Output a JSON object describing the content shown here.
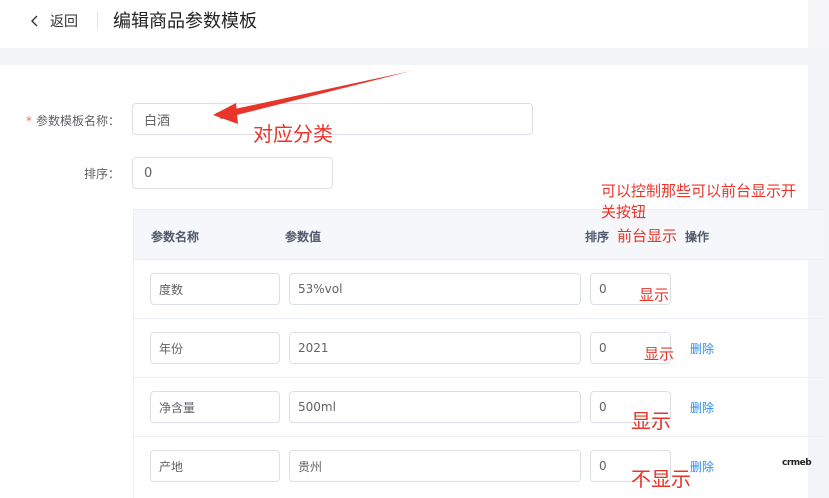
{
  "header": {
    "back_label": "返回",
    "title": "编辑商品参数模板"
  },
  "form": {
    "name_label": "参数模板名称：",
    "name_value": "白酒",
    "sort_label": "排序：",
    "sort_value": "0"
  },
  "table": {
    "columns": [
      "参数名称",
      "参数值",
      "排序",
      "操作"
    ],
    "delete_label": "删除",
    "rows": [
      {
        "name": "度数",
        "value": "53%vol",
        "sort": "0"
      },
      {
        "name": "年份",
        "value": "2021",
        "sort": "0"
      },
      {
        "name": "净含量",
        "value": "500ml",
        "sort": "0"
      },
      {
        "name": "产地",
        "value": "贵州",
        "sort": "0"
      }
    ]
  },
  "annotations": {
    "category": "对应分类",
    "note_line1": "可以控制那些可以前台显示开",
    "note_line2": "关按钮",
    "frontend_display": "前台显示",
    "row1": "显示",
    "row2": "显示",
    "row3": "显示",
    "row4": "不显示"
  },
  "logo_text": "crmeb",
  "colors": {
    "annotation": "#e8352a",
    "link": "#2d8cf0",
    "required": "#f56c6c"
  }
}
